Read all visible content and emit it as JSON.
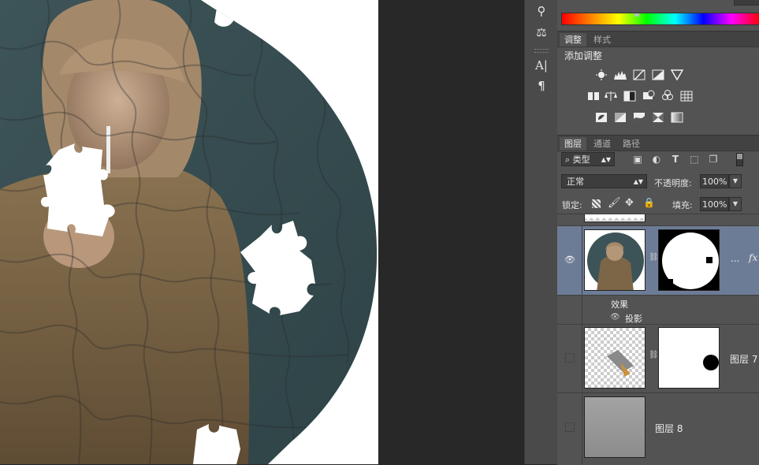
{
  "adjustments_panel": {
    "tabs": [
      "调整",
      "样式"
    ],
    "title": "添加调整",
    "icon_rows": [
      [
        "brightness-contrast-icon",
        "levels-icon",
        "curves-icon",
        "exposure-icon",
        "triangle-icon"
      ],
      [
        "vibrance-icon",
        "color-balance-icon",
        "black-white-icon",
        "photo-filter-icon",
        "channel-mixer-icon",
        "color-lookup-icon"
      ],
      [
        "invert-icon",
        "posterize-icon",
        "threshold-icon",
        "selective-color-icon",
        "gradient-map-icon"
      ]
    ]
  },
  "layers_panel": {
    "tabs": [
      "图层",
      "通道",
      "路径"
    ],
    "filter_search_icon": "⌕",
    "filter_type": "类型",
    "blend_mode": "正常",
    "opacity_label": "不透明度:",
    "opacity_value": "100%",
    "lock_label": "锁定:",
    "fill_label": "填充:",
    "fill_value": "100%",
    "layers": [
      {
        "name": "...",
        "fx": "fx",
        "selected": true,
        "visible": true
      },
      {
        "name": "图层 7",
        "selected": false,
        "visible": false
      },
      {
        "name": "图层 8",
        "selected": false,
        "visible": false
      }
    ],
    "effects_label": "效果",
    "effect_item": "投影"
  },
  "colors": {
    "canvas_bg": "#ffffff",
    "pasteboard": "#282828",
    "panel_bg": "#535353",
    "selected_layer": "#6d7c96"
  }
}
